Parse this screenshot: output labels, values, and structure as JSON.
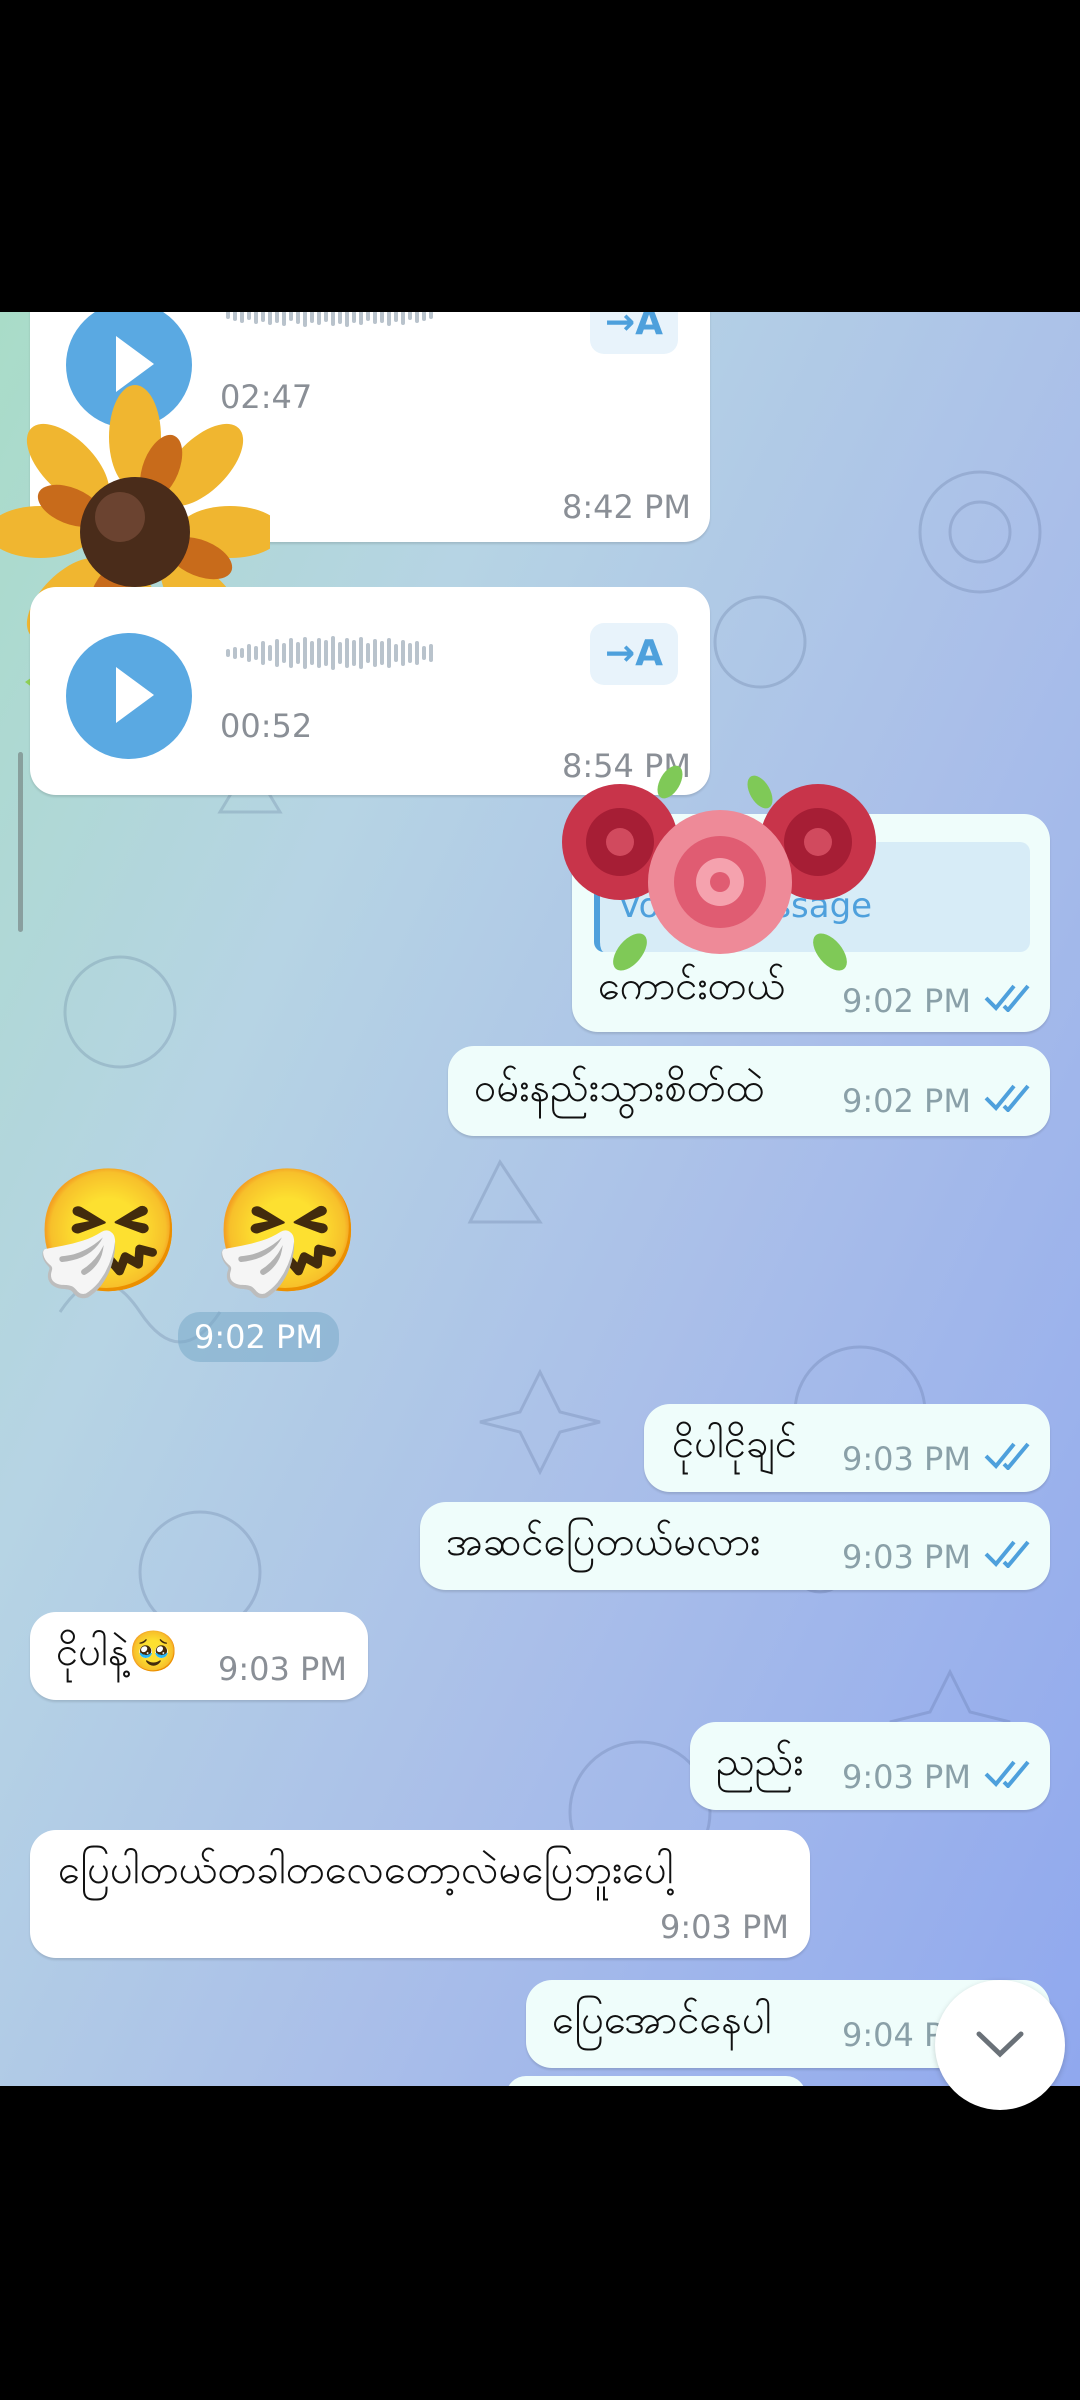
{
  "messages": {
    "voice1": {
      "duration": "02:47",
      "time": "8:42 PM",
      "transcribe": "→A"
    },
    "voice2": {
      "duration": "00:52",
      "time": "8:54 PM",
      "transcribe": "→A"
    },
    "reply_preview": "Voice message",
    "m1": {
      "text": "ကောင်းတယ်",
      "time": "9:02 PM"
    },
    "m2": {
      "text": "ဝမ်းနည်းသွားစိတ်ထဲ",
      "time": "9:02 PM"
    },
    "emoji_time": "9:02 PM",
    "m3": {
      "text": "ငိုပါငိုချင်",
      "time": "9:03 PM"
    },
    "m4": {
      "text": "အဆင်ပြေတယ်မလား",
      "time": "9:03 PM"
    },
    "m5": {
      "text": "ငိုပါနဲ့🥹",
      "time": "9:03 PM"
    },
    "m6": {
      "text": "ညည်း",
      "time": "9:03 PM"
    },
    "m7": {
      "text": "ပြေပါတယ်တခါတလေတော့လဲမပြေဘူးပေါ့",
      "time": "9:03 PM"
    },
    "m8": {
      "text": "ပြေအောင်နေပါ",
      "time": "9:04 PM"
    }
  },
  "colors": {
    "accent": "#4ea0dc",
    "out_bubble": "#effdfb",
    "in_bubble": "#ffffff"
  }
}
